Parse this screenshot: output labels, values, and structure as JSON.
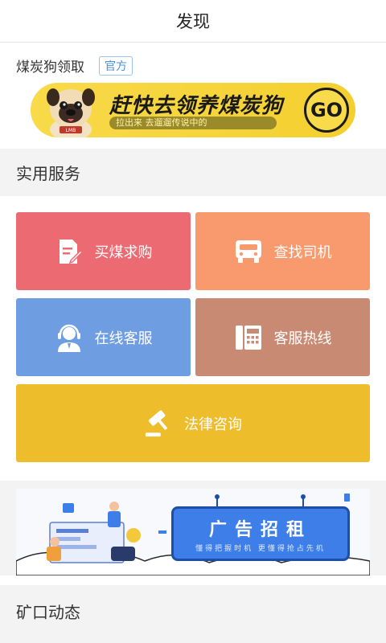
{
  "header": {
    "title": "发现"
  },
  "promo": {
    "title": "煤炭狗领取",
    "badge": "官方",
    "banner_main": "赶快去领养煤炭狗",
    "banner_sub": "拉出来 去遛遛传说中的",
    "dog_tag": "LMB",
    "go_label": "GO"
  },
  "services": {
    "heading": "实用服务",
    "tiles": [
      {
        "label": "买煤求购",
        "icon": "document-edit-icon",
        "color": "#ec6b72"
      },
      {
        "label": "查找司机",
        "icon": "truck-icon",
        "color": "#f99a6e"
      },
      {
        "label": "在线客服",
        "icon": "customer-service-icon",
        "color": "#6f9de2"
      },
      {
        "label": "客服热线",
        "icon": "phone-hotline-icon",
        "color": "#c98a74"
      },
      {
        "label": "法律咨询",
        "icon": "gavel-icon",
        "color": "#edbd2c"
      }
    ]
  },
  "ad": {
    "main": "广告招租",
    "sub": "懂得把握时机 更懂得抢占先机"
  },
  "mine": {
    "heading": "矿口动态"
  }
}
